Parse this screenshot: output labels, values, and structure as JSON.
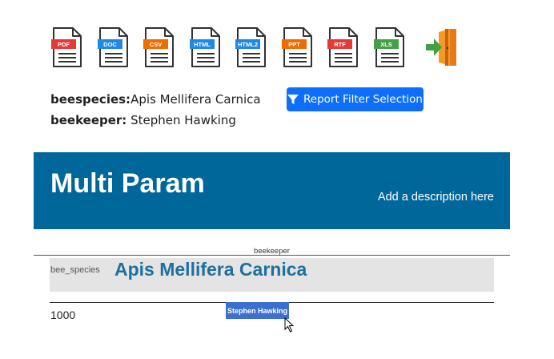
{
  "toolbar": {
    "exports": [
      {
        "label": "PDF",
        "color": "#e53935"
      },
      {
        "label": "DOC",
        "color": "#1e88e5"
      },
      {
        "label": "CSV",
        "color": "#ef6c00"
      },
      {
        "label": "HTML",
        "color": "#1e88e5"
      },
      {
        "label": "HTML2",
        "color": "#1e88e5"
      },
      {
        "label": "PPT",
        "color": "#ef6c00"
      },
      {
        "label": "RTF",
        "color": "#e53935"
      },
      {
        "label": "XLS",
        "color": "#43a047"
      }
    ],
    "exit_icon": "exit-door-icon"
  },
  "filters": {
    "species_key": "beespecies:",
    "species_value": "Apis Mellifera Carnica",
    "keeper_key": "beekeeper:",
    "keeper_value": "Stephen Hawking"
  },
  "report_button": {
    "label": "Report Filter Selection",
    "icon": "filter-icon",
    "color": "#0d6efd"
  },
  "banner": {
    "title": "Multi Param",
    "description": "Add a description here",
    "color": "#00679b"
  },
  "table": {
    "column_header": "beekeeper",
    "row_label": "bee_species",
    "row_value": "Apis Mellifera Carnica",
    "cell_value": "1000",
    "cell_tag": "Stephen Hawking"
  }
}
